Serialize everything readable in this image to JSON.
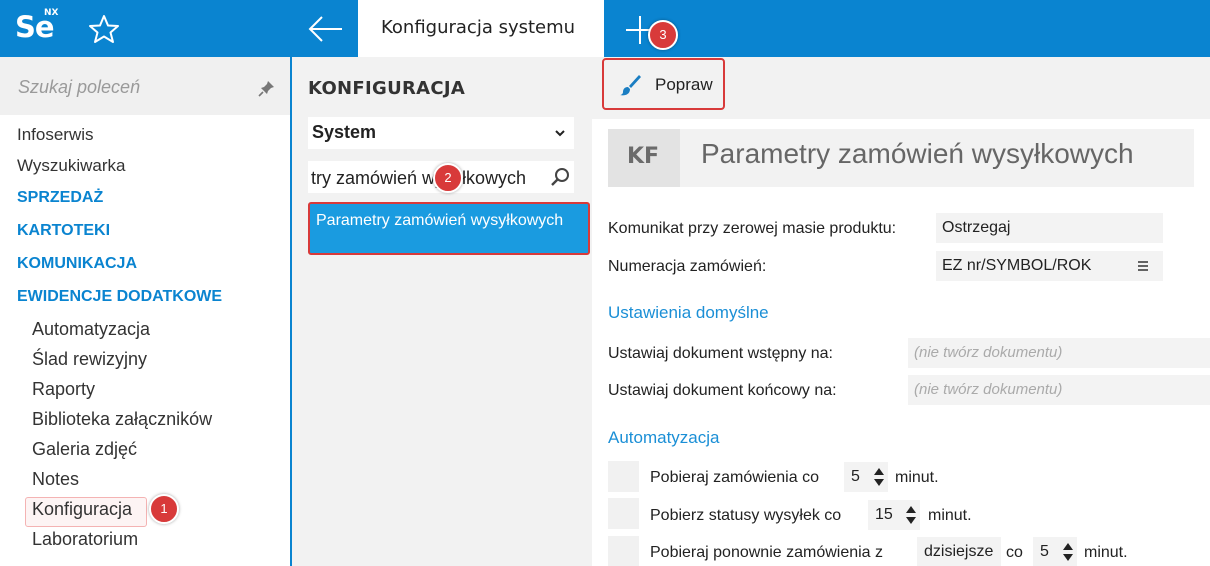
{
  "app": {
    "logo_text": "Se",
    "logo_sup": "NX",
    "active_tab": "Konfiguracja systemu"
  },
  "sidebar": {
    "search_placeholder": "Szukaj poleceń",
    "items": [
      {
        "label": "Infoserwis",
        "type": "item"
      },
      {
        "label": "Wyszukiwarka",
        "type": "item"
      },
      {
        "label": "SPRZEDAŻ",
        "type": "section"
      },
      {
        "label": "KARTOTEKI",
        "type": "section"
      },
      {
        "label": "KOMUNIKACJA",
        "type": "section"
      },
      {
        "label": "EWIDENCJE DODATKOWE",
        "type": "section"
      }
    ],
    "subitems": [
      "Automatyzacja",
      "Ślad rewizyjny",
      "Raporty",
      "Biblioteka załączników",
      "Galeria zdjęć",
      "Notes",
      "Konfiguracja",
      "Laboratorium"
    ]
  },
  "middle": {
    "title": "KONFIGURACJA",
    "select_value": "System",
    "search_value": "try zamówień wysyłkowych",
    "result_label": "Parametry zamówień wysyłkowych"
  },
  "right": {
    "toolbar_button": "Popraw",
    "badge_code": "KF",
    "page_title": "Parametry zamówień wysyłkowych",
    "fields": {
      "zero_mass_label": "Komunikat przy zerowej masie produktu:",
      "zero_mass_value": "Ostrzegaj",
      "numbering_label": "Numeracja zamówień:",
      "numbering_value": "EZ nr/SYMBOL/ROK"
    },
    "defaults_section": "Ustawienia domyślne",
    "defaults": {
      "initial_label": "Ustawiaj dokument wstępny na:",
      "initial_placeholder": "(nie twórz dokumentu)",
      "final_label": "Ustawiaj dokument końcowy na:",
      "final_placeholder": "(nie twórz dokumentu)"
    },
    "automation_section": "Automatyzacja",
    "automation": {
      "row1_pre": "Pobieraj zamówienia co",
      "row1_value": "5",
      "row1_post": "minut.",
      "row2_pre": "Pobierz statusy wysyłek co",
      "row2_value": "15",
      "row2_post": "minut.",
      "row3_pre": "Pobieraj ponownie zamówienia z",
      "row3_select": "dzisiejsze",
      "row3_mid": "co",
      "row3_value": "5",
      "row3_post": "minut."
    }
  },
  "annotations": [
    "1",
    "2",
    "3"
  ],
  "colors": {
    "accent": "#0a84d0",
    "selection": "#1a9be0",
    "annotation": "#d83a3a"
  }
}
